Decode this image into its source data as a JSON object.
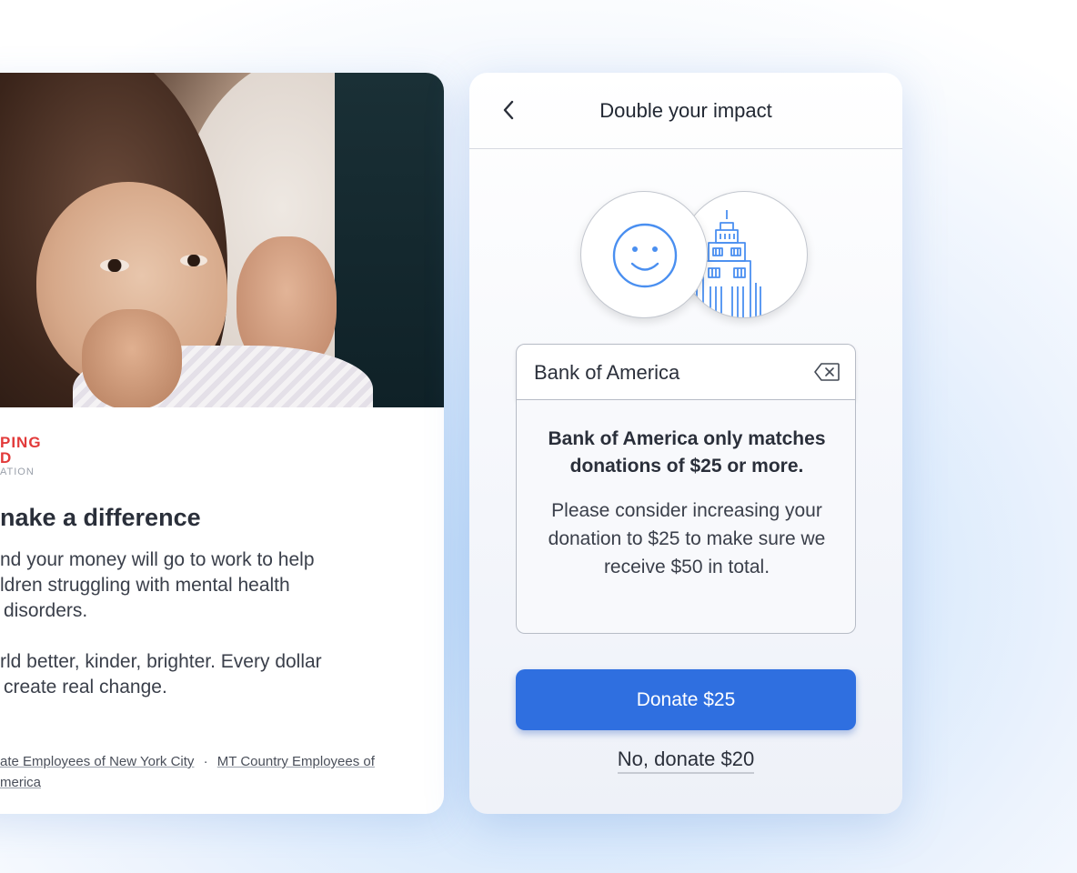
{
  "left_card": {
    "logo": {
      "line1": "PING",
      "line2": "D",
      "line3": "ATION"
    },
    "title": "nake a difference",
    "body_lines": [
      "nd your money will go to work to help",
      "ldren struggling with mental health",
      "disorders."
    ],
    "body_lines_2": [
      "rld better, kinder, brighter. Every dollar",
      "create real change."
    ],
    "links": {
      "link1": "ate Employees of New York City",
      "separator": "·",
      "link2": "MT Country Employees of",
      "link2_cont": "merica"
    }
  },
  "right_card": {
    "header": {
      "title": "Double your impact",
      "back_icon": "chevron-left-icon"
    },
    "icons": {
      "person": "smiley-face-icon",
      "company": "building-icon"
    },
    "search": {
      "value": "Bank of America",
      "clear_icon": "backspace-clear-icon"
    },
    "message": {
      "title_line1": "Bank of America only matches",
      "title_line2": "donations of $25 or more.",
      "body_line1": "Please consider increasing your",
      "body_line2": "donation to $25 to make sure we",
      "body_line3": "receive $50 in total."
    },
    "primary_button": "Donate $25",
    "secondary_link": "No, donate $20",
    "colors": {
      "primary": "#2f6fe0",
      "icon_blue": "#4a8ff0",
      "logo_red": "#e23a3a"
    }
  }
}
